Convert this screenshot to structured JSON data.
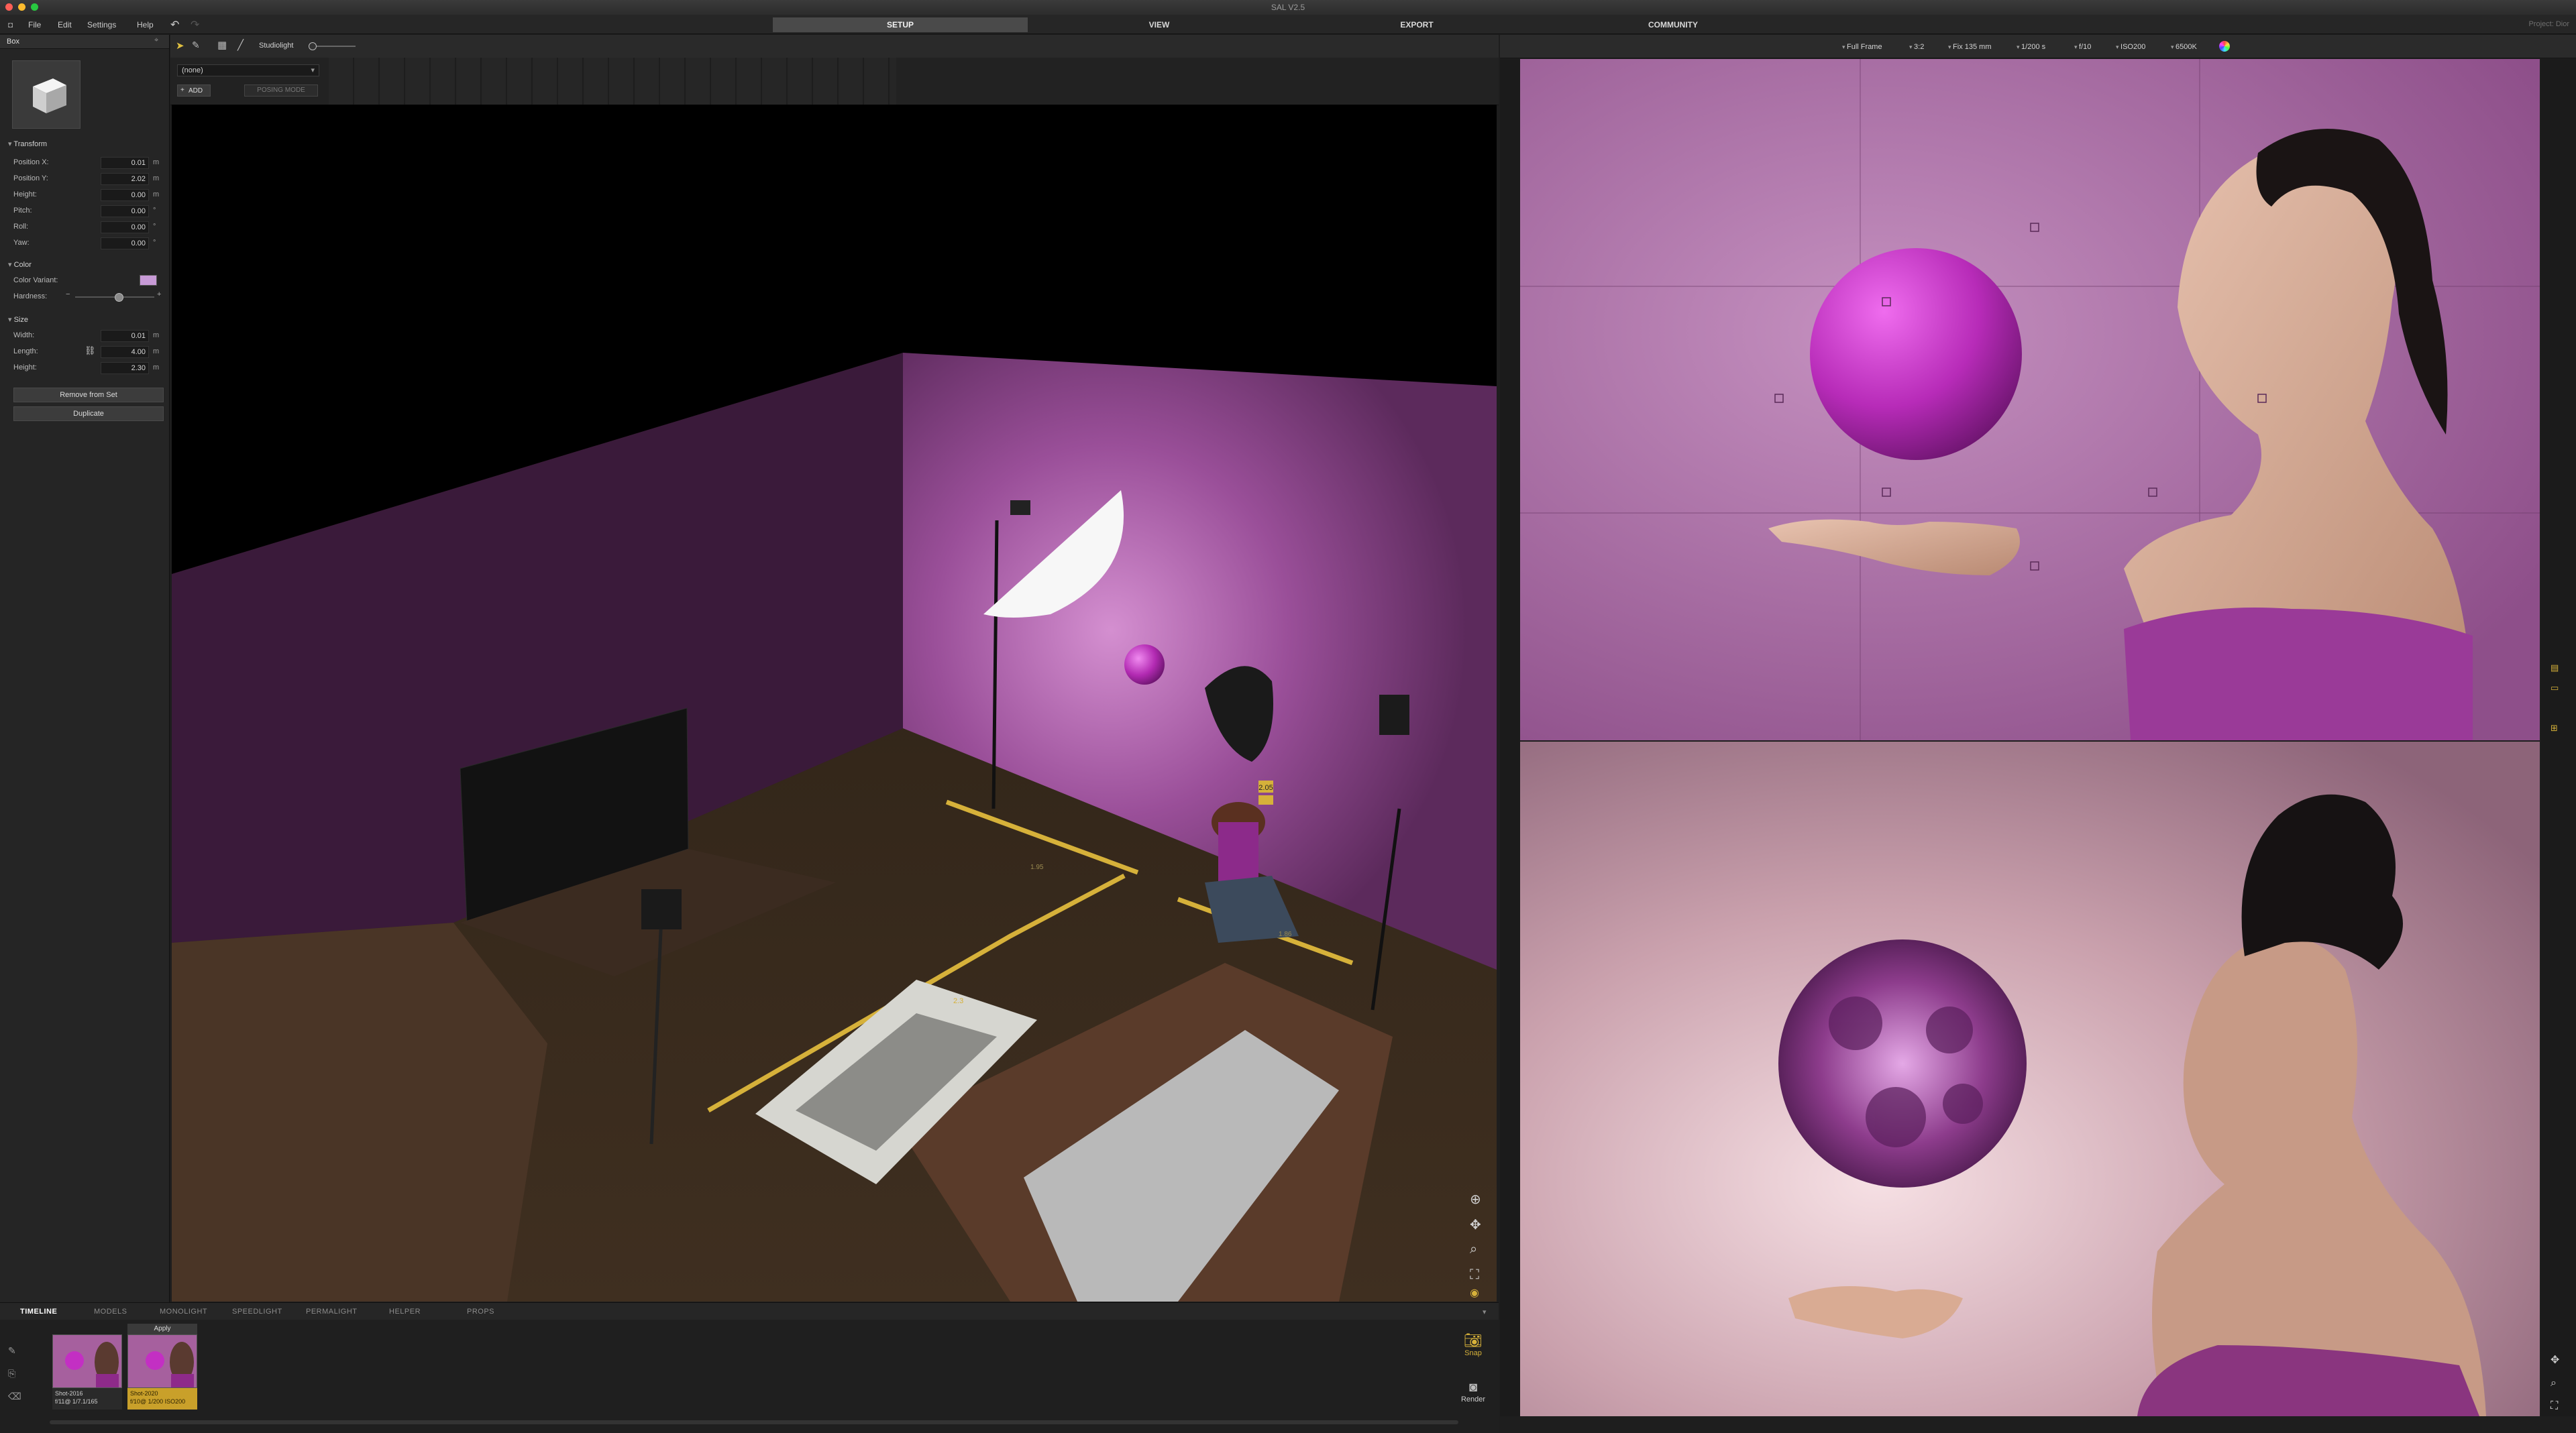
{
  "app": {
    "title": "SAL V2.5",
    "project": "Project: Dior"
  },
  "menu": [
    "File",
    "Edit",
    "Settings",
    "Help"
  ],
  "main_tabs": [
    "SETUP",
    "VIEW",
    "EXPORT",
    "COMMUNITY"
  ],
  "toolbar": {
    "studiolight_label": "Studiolight"
  },
  "pose": {
    "model_select": "(none)",
    "add_label": "ADD",
    "posing_label": "POSING MODE"
  },
  "panel": {
    "object_name": "Box",
    "transform_title": "Transform",
    "transform": [
      {
        "label": "Position X:",
        "value": "0.01",
        "unit": "m"
      },
      {
        "label": "Position Y:",
        "value": "2.02",
        "unit": "m"
      },
      {
        "label": "Height:",
        "value": "0.00",
        "unit": "m"
      },
      {
        "label": "Pitch:",
        "value": "0.00",
        "unit": "°"
      },
      {
        "label": "Roll:",
        "value": "0.00",
        "unit": "°"
      },
      {
        "label": "Yaw:",
        "value": "0.00",
        "unit": "°"
      }
    ],
    "color_title": "Color",
    "color_variant_label": "Color Variant:",
    "color_variant_swatch": "#c79ad6",
    "hardness_label": "Hardness:",
    "hardness_level": 0.55,
    "size_title": "Size",
    "size": [
      {
        "label": "Width:",
        "value": "0.01",
        "unit": "m"
      },
      {
        "label": "Length:",
        "value": "4.00",
        "unit": "m"
      },
      {
        "label": "Height:",
        "value": "2.30",
        "unit": "m"
      }
    ],
    "remove_label": "Remove from Set",
    "duplicate_label": "Duplicate"
  },
  "camera": {
    "format": "Full Frame",
    "ratio": "3:2",
    "lens": "Fix 135 mm",
    "shutter": "1/200 s",
    "aperture": "f/10",
    "iso": "ISO200",
    "white_balance": "6500K"
  },
  "scene_labels": {
    "distance_1": "2.05",
    "distance_2": "1.95",
    "distance_3": "1.86",
    "table_tag": "2.3"
  },
  "bottom_tabs": [
    "TIMELINE",
    "MODELS",
    "MONOLIGHT",
    "SPEEDLIGHT",
    "PERMALIGHT",
    "HELPER",
    "PROPS"
  ],
  "timeline": {
    "apply_label": "Apply",
    "shots": [
      {
        "name": "Shot-2016",
        "meta": "f/11@ 1/7.1/165"
      },
      {
        "name": "Shot-2020",
        "meta": "f/10@ 1/200 ISO200"
      }
    ],
    "snap_label": "Snap",
    "render_label": "Render"
  },
  "colors": {
    "accent_yellow": "#d6b13a",
    "wall_purple": "#a0609a",
    "ball_magenta": "#b82ab8"
  }
}
